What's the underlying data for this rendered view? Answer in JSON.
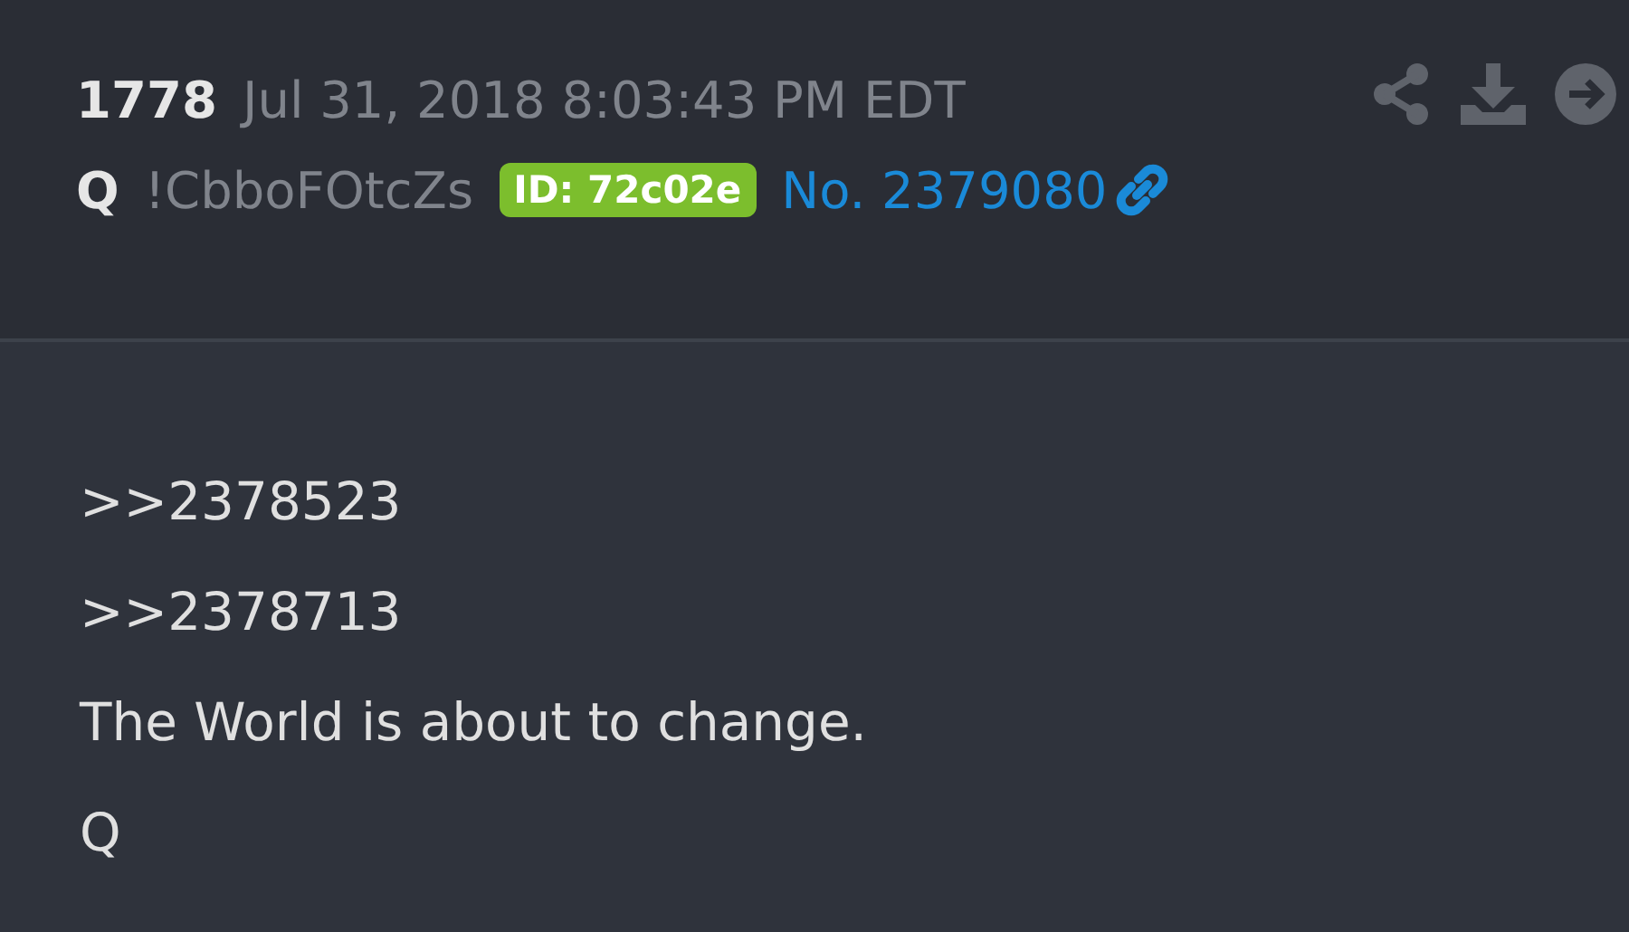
{
  "post": {
    "number": "1778",
    "date": "Jul 31, 2018 8:03:43 PM EDT",
    "author": "Q",
    "tripcode": "!CbboFOtcZs",
    "id_badge": "ID: 72c02e",
    "post_no": "No. 2379080"
  },
  "body": {
    "lines": [
      ">>2378523",
      ">>2378713",
      "The World is about to change.",
      "Q"
    ]
  }
}
